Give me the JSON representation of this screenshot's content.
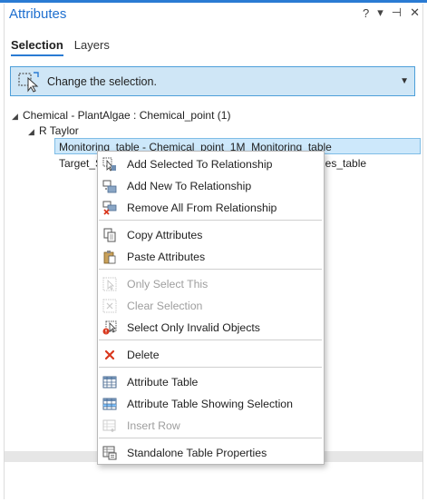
{
  "pane": {
    "title": "Attributes",
    "controls": {
      "help": "?",
      "menu": "▾",
      "pin": "⊣",
      "close": "✕"
    }
  },
  "tabs": [
    {
      "label": "Selection",
      "active": true
    },
    {
      "label": "Layers",
      "active": false
    }
  ],
  "mode_combo": {
    "label": "Change the selection."
  },
  "tree": {
    "root": "Chemical - PlantAlgae : Chemical_point (1)",
    "child": "R Taylor",
    "selected_row": "Monitoring_table - Chemical_point_1M_Monitoring_table",
    "row2_left": "Target_S",
    "row2_right": "ies_table"
  },
  "context_menu": {
    "items": [
      {
        "label": "Add Selected To Relationship",
        "icon": "add-selected-icon",
        "enabled": true
      },
      {
        "label": "Add New To Relationship",
        "icon": "add-new-icon",
        "enabled": true
      },
      {
        "label": "Remove All From Relationship",
        "icon": "remove-all-icon",
        "enabled": true
      },
      {
        "label": "Copy Attributes",
        "icon": "copy-icon",
        "enabled": true
      },
      {
        "label": "Paste Attributes",
        "icon": "paste-icon",
        "enabled": true
      },
      {
        "label": "Only Select This",
        "icon": "select-this-icon",
        "enabled": false
      },
      {
        "label": "Clear Selection",
        "icon": "clear-selection-icon",
        "enabled": false
      },
      {
        "label": "Select Only Invalid Objects",
        "icon": "invalid-objects-icon",
        "enabled": true
      },
      {
        "label": "Delete",
        "icon": "delete-icon",
        "enabled": true
      },
      {
        "label": "Attribute Table",
        "icon": "table-icon",
        "enabled": true
      },
      {
        "label": "Attribute Table Showing Selection",
        "icon": "table-selection-icon",
        "enabled": true
      },
      {
        "label": "Insert Row",
        "icon": "insert-row-icon",
        "enabled": false
      },
      {
        "label": "Standalone Table Properties",
        "icon": "table-properties-icon",
        "enabled": true
      }
    ]
  },
  "colors": {
    "accent": "#2a7bd3",
    "combo_bg": "#cfe6f6",
    "selected_row": "#cde8fb",
    "delete_red": "#d9381e"
  }
}
